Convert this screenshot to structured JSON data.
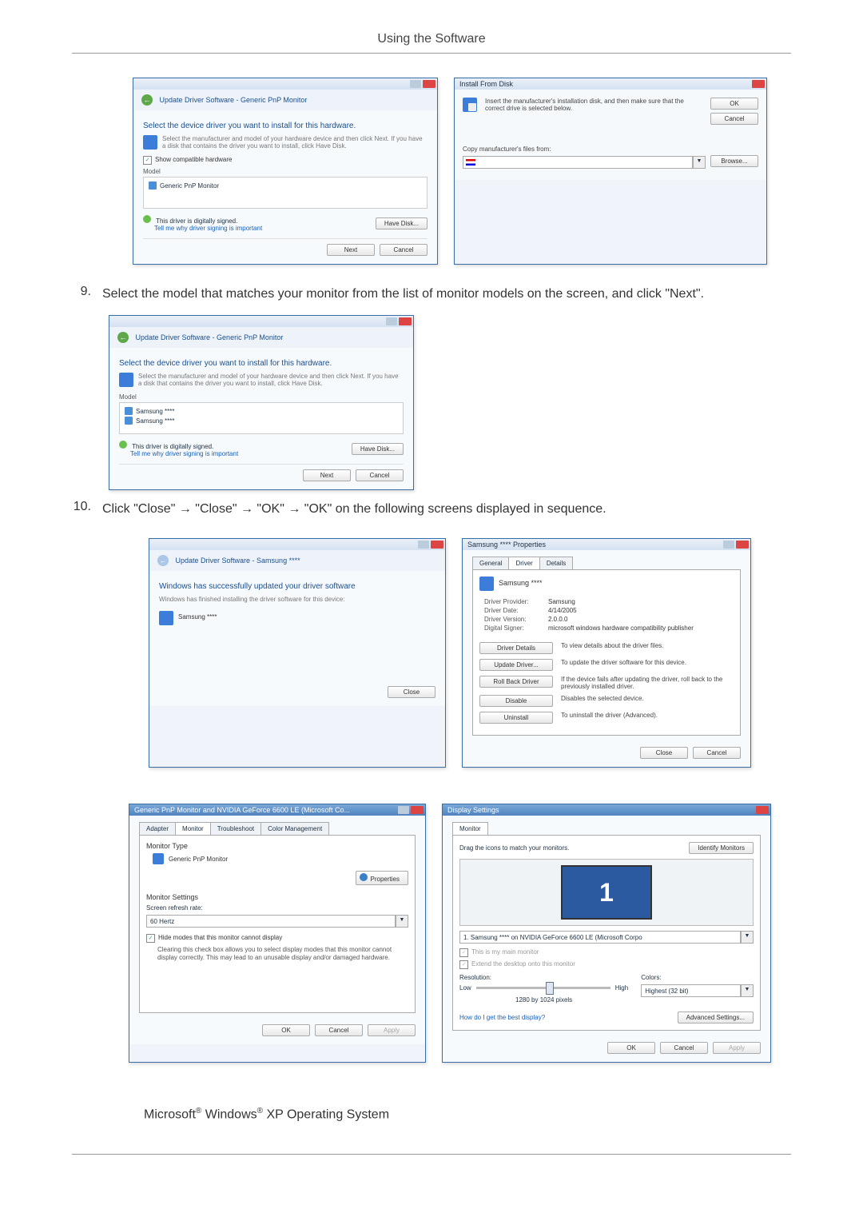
{
  "header": {
    "title": "Using the Software"
  },
  "steps": {
    "s9": {
      "num": "9.",
      "text": "Select the model that matches your monitor from the list of monitor models on the screen, and click \"Next\"."
    },
    "s10": {
      "num": "10.",
      "text": "Click \"Close\" → \"Close\" → \"OK\" → \"OK\" on the following screens displayed in sequence."
    }
  },
  "footer": {
    "prefix": "Microsoft",
    "reg1": "®",
    "middle": " Windows",
    "reg2": "®",
    "suffix": " XP Operating System"
  },
  "common_buttons": {
    "next": "Next",
    "cancel": "Cancel",
    "ok": "OK",
    "close": "Close",
    "apply": "Apply",
    "browse": "Browse...",
    "have_disk": "Have Disk..."
  },
  "update_driver_1": {
    "breadcrumb": "Update Driver Software - Generic PnP Monitor",
    "title": "Select the device driver you want to install for this hardware.",
    "subtitle": "Select the manufacturer and model of your hardware device and then click Next. If you have a disk that contains the driver you want to install, click Have Disk.",
    "checkbox_label": "Show compatible hardware",
    "list_header": "Model",
    "items": [
      "Generic PnP Monitor"
    ],
    "signed_label": "This driver is digitally signed.",
    "signed_link": "Tell me why driver signing is important"
  },
  "install_from_disk": {
    "title": "Install From Disk",
    "message": "Insert the manufacturer's installation disk, and then make sure that the correct drive is selected below.",
    "copy_label": "Copy manufacturer's files from:"
  },
  "update_driver_2": {
    "breadcrumb": "Update Driver Software - Generic PnP Monitor",
    "title": "Select the device driver you want to install for this hardware.",
    "subtitle": "Select the manufacturer and model of your hardware device and then click Next. If you have a disk that contains the driver you want to install, click Have Disk.",
    "list_header": "Model",
    "items": [
      "Samsung ****",
      "Samsung ****"
    ],
    "signed_label": "This driver is digitally signed.",
    "signed_link": "Tell me why driver signing is important"
  },
  "update_success": {
    "breadcrumb": "Update Driver Software - Samsung ****",
    "title": "Windows has successfully updated your driver software",
    "subtitle": "Windows has finished installing the driver software for this device:",
    "device": "Samsung ****"
  },
  "driver_props": {
    "title": "Samsung **** Properties",
    "tabs": [
      "General",
      "Driver",
      "Details"
    ],
    "device": "Samsung ****",
    "kv": {
      "provider_k": "Driver Provider:",
      "provider_v": "Samsung",
      "date_k": "Driver Date:",
      "date_v": "4/14/2005",
      "version_k": "Driver Version:",
      "version_v": "2.0.0.0",
      "signer_k": "Digital Signer:",
      "signer_v": "microsoft windows hardware compatibility publisher"
    },
    "btns": {
      "details": "Driver Details",
      "details_d": "To view details about the driver files.",
      "update": "Update Driver...",
      "update_d": "To update the driver software for this device.",
      "rollback": "Roll Back Driver",
      "rollback_d": "If the device fails after updating the driver, roll back to the previously installed driver.",
      "disable": "Disable",
      "disable_d": "Disables the selected device.",
      "uninstall": "Uninstall",
      "uninstall_d": "To uninstall the driver (Advanced)."
    }
  },
  "monitor_props": {
    "title": "Generic PnP Monitor and NVIDIA GeForce 6600 LE (Microsoft Co...",
    "tabs": [
      "Adapter",
      "Monitor",
      "Troubleshoot",
      "Color Management"
    ],
    "monitor_type_label": "Monitor Type",
    "monitor_type_value": "Generic PnP Monitor",
    "properties_btn": "Properties",
    "settings_label": "Monitor Settings",
    "refresh_label": "Screen refresh rate:",
    "refresh_value": "60 Hertz",
    "hide_modes": "Hide modes that this monitor cannot display",
    "hide_modes_note": "Clearing this check box allows you to select display modes that this monitor cannot display correctly. This may lead to an unusable display and/or damaged hardware."
  },
  "display_settings": {
    "title": "Display Settings",
    "tab": "Monitor",
    "drag_label": "Drag the icons to match your monitors.",
    "identify_btn": "Identify Monitors",
    "monitor_number": "1",
    "dropdown": "1. Samsung **** on NVIDIA GeForce 6600 LE (Microsoft Corpo",
    "main_check": "This is my main monitor",
    "extend_check": "Extend the desktop onto this monitor",
    "res_label": "Resolution:",
    "res_low": "Low",
    "res_high": "High",
    "res_value": "1280 by 1024 pixels",
    "colors_label": "Colors:",
    "colors_value": "Highest (32 bit)",
    "best_link": "How do I get the best display?",
    "adv_btn": "Advanced Settings..."
  }
}
